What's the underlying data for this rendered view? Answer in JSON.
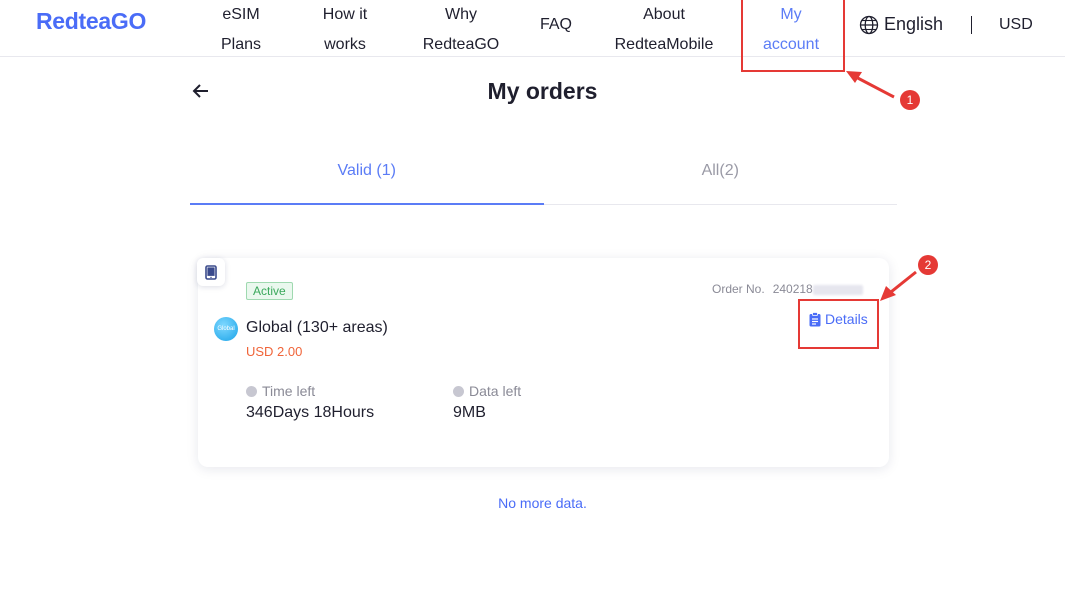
{
  "header": {
    "logo": "RedteaGO",
    "nav": [
      {
        "line1": "eSIM",
        "line2": "Plans"
      },
      {
        "line1": "How it",
        "line2": "works"
      },
      {
        "line1": "Why",
        "line2": "RedteaGO"
      },
      {
        "label": "FAQ"
      },
      {
        "line1": "About",
        "line2": "RedteaMobile"
      },
      {
        "line1": "My",
        "line2": "account"
      }
    ],
    "language": "English",
    "currency": "USD"
  },
  "page": {
    "title": "My orders"
  },
  "tabs": [
    {
      "label": "Valid (1)",
      "active": true
    },
    {
      "label": "All(2)",
      "active": false
    }
  ],
  "order": {
    "status": "Active",
    "order_no_label": "Order No.",
    "order_no": "240218",
    "plan_icon_text": "Global",
    "plan_name": "Global (130+ areas)",
    "price": "USD 2.00",
    "details_label": "Details",
    "time_left_label": "Time left",
    "time_left_value": "346Days 18Hours",
    "data_left_label": "Data left",
    "data_left_value": "9MB"
  },
  "footer_text": "No more data.",
  "annotations": {
    "badge1": "1",
    "badge2": "2"
  },
  "colors": {
    "accent": "#5b7cf6",
    "brand": "#4a6cf7",
    "annotation": "#e53935",
    "price": "#f0653a",
    "active_status": "#3aa85b"
  }
}
